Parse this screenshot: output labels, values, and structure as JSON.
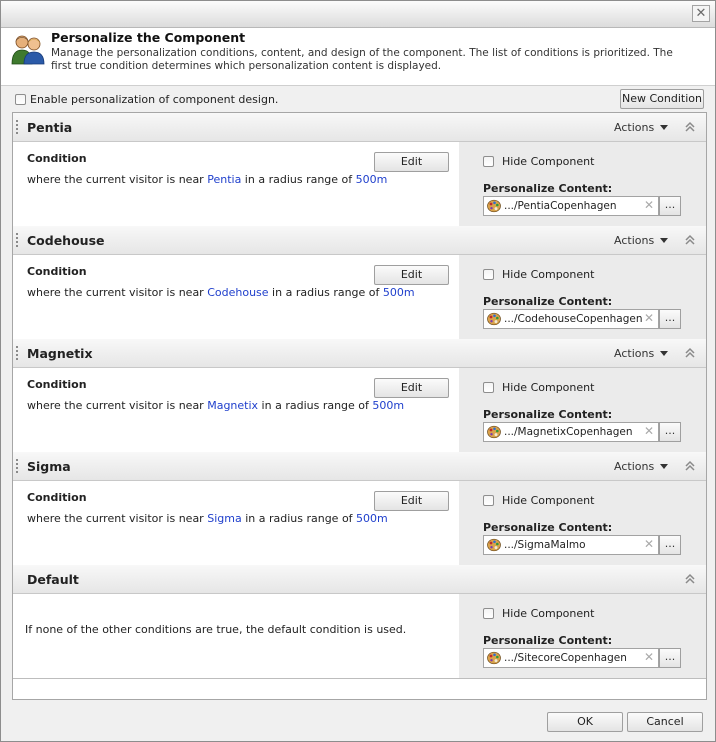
{
  "dialog": {
    "close_label": "✕",
    "title": "Personalize the Component",
    "description": "Manage the personalization conditions, content, and design of the component. The list of conditions is prioritized. The first true condition determines which personalization content is displayed."
  },
  "toolbar": {
    "enable_label": "Enable personalization of component design.",
    "new_condition_label": "New Condition"
  },
  "labels": {
    "condition": "Condition",
    "edit": "Edit",
    "actions": "Actions",
    "hide_component": "Hide Component",
    "personalize_content": "Personalize Content:",
    "text_prefix": "where the current visitor is near ",
    "text_middle": " in a radius range of ",
    "browse": "...",
    "clear": "✕"
  },
  "conditions": [
    {
      "name": "Pentia",
      "place": "Pentia",
      "radius": "500m",
      "content": ".../PentiaCopenhagen"
    },
    {
      "name": "Codehouse",
      "place": "Codehouse",
      "radius": "500m",
      "content": ".../CodehouseCopenhagen"
    },
    {
      "name": "Magnetix",
      "place": "Magnetix",
      "radius": "500m",
      "content": ".../MagnetixCopenhagen"
    },
    {
      "name": "Sigma",
      "place": "Sigma",
      "radius": "500m",
      "content": ".../SigmaMalmo"
    }
  ],
  "default_condition": {
    "name": "Default",
    "text": "If none of the other conditions are true, the default condition is used.",
    "content": ".../SitecoreCopenhagen"
  },
  "footer": {
    "ok_label": "OK",
    "cancel_label": "Cancel"
  },
  "icons": {
    "header": "users-icon",
    "content_item": "palette-icon",
    "collapse": "chevron-up-icon",
    "grip": "drag-grip-icon"
  },
  "colors": {
    "link": "#1f3fcc"
  }
}
